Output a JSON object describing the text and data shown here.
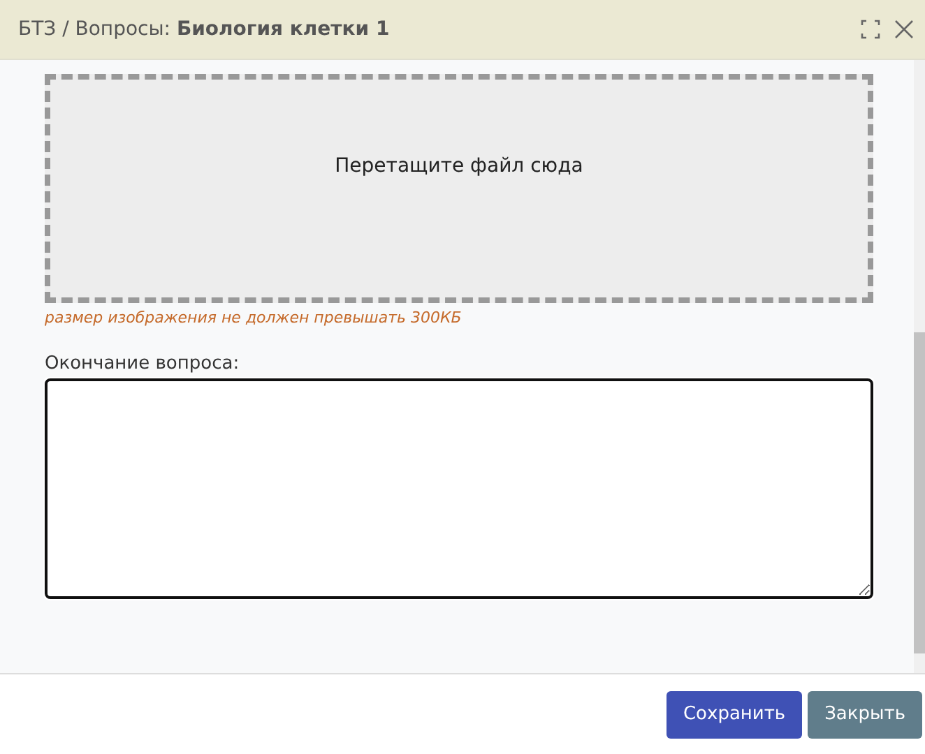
{
  "window": {
    "title": "БТЗ / Вопросы: **Биология клетки 1**"
  },
  "dropzone": {
    "label": "Перетащите файл сюда",
    "hint": "размер изображения не должен превышать 300КБ"
  },
  "question_ending": {
    "label": "Окончание вопроса:"
  },
  "buttons": [
    {
      "label": "Сохранить",
      "kind": "primary"
    },
    {
      "label": "Закрыть",
      "kind": "secondary"
    }
  ]
}
